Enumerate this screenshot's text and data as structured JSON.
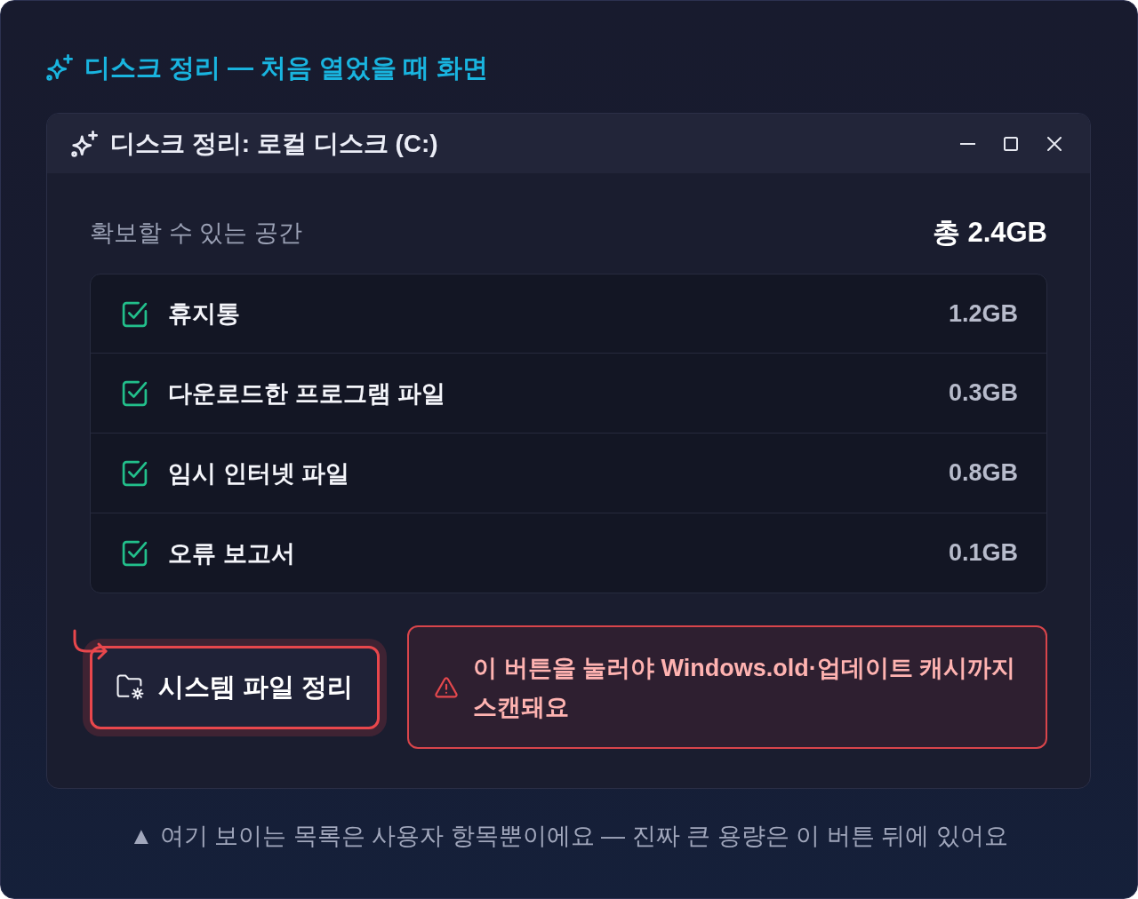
{
  "heading": {
    "title": "디스크 정리 — 처음 열었을 때 화면"
  },
  "window": {
    "title": "디스크 정리: 로컬 디스크 (C:)"
  },
  "summary": {
    "label": "확보할 수 있는 공간",
    "total": "총 2.4GB"
  },
  "items": [
    {
      "label": "휴지통",
      "size": "1.2GB",
      "checked": true
    },
    {
      "label": "다운로드한 프로그램 파일",
      "size": "0.3GB",
      "checked": true
    },
    {
      "label": "임시 인터넷 파일",
      "size": "0.8GB",
      "checked": true
    },
    {
      "label": "오류 보고서",
      "size": "0.1GB",
      "checked": true
    }
  ],
  "system_button": {
    "label": "시스템 파일 정리",
    "highlighted": true
  },
  "warning": {
    "text": "이 버튼을 눌러야 Windows.old·업데이트 캐시까지 스캔돼요"
  },
  "footnote": {
    "text": "▲ 여기 보이는 목록은 사용자 항목뿐이에요 — 진짜 큰 용량은 이 버튼 뒤에 있어요"
  }
}
